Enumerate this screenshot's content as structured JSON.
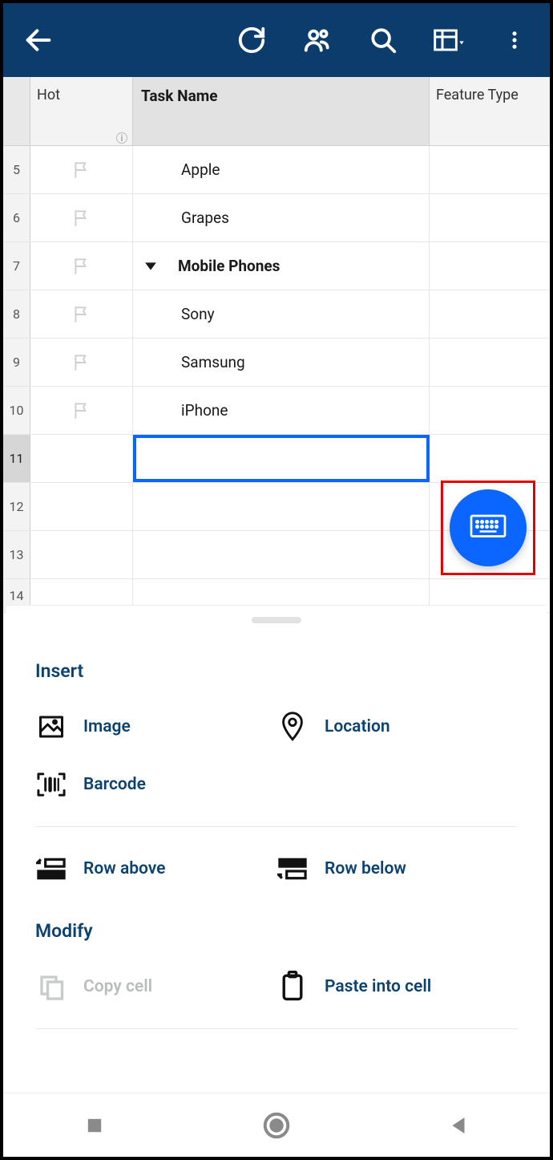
{
  "header": {},
  "columns": {
    "hot": "Hot",
    "task": "Task Name",
    "feature_type": "Feature Type"
  },
  "rows": [
    {
      "num": "5",
      "task": "Apple",
      "indent": 1,
      "group": false,
      "flag": true
    },
    {
      "num": "6",
      "task": "Grapes",
      "indent": 1,
      "group": false,
      "flag": true
    },
    {
      "num": "7",
      "task": "Mobile Phones",
      "indent": 0,
      "group": true,
      "flag": true
    },
    {
      "num": "8",
      "task": "Sony",
      "indent": 1,
      "group": false,
      "flag": true
    },
    {
      "num": "9",
      "task": "Samsung",
      "indent": 1,
      "group": false,
      "flag": true
    },
    {
      "num": "10",
      "task": "iPhone",
      "indent": 1,
      "group": false,
      "flag": true
    },
    {
      "num": "11",
      "task": "",
      "indent": 0,
      "group": false,
      "flag": false,
      "selected": true
    },
    {
      "num": "12",
      "task": "",
      "indent": 0,
      "group": false,
      "flag": false
    },
    {
      "num": "13",
      "task": "",
      "indent": 0,
      "group": false,
      "flag": false
    },
    {
      "num": "14",
      "task": "",
      "indent": 0,
      "group": false,
      "flag": false,
      "short": true
    }
  ],
  "sheet": {
    "sections": [
      {
        "title": "Insert",
        "options": [
          {
            "icon": "image",
            "label": "Image"
          },
          {
            "icon": "location",
            "label": "Location"
          },
          {
            "icon": "barcode",
            "label": "Barcode"
          },
          {
            "icon": "",
            "label": ""
          }
        ],
        "row_actions": [
          {
            "icon": "row-above",
            "label": "Row above"
          },
          {
            "icon": "row-below",
            "label": "Row below"
          }
        ]
      },
      {
        "title": "Modify",
        "options": [
          {
            "icon": "copy",
            "label": "Copy cell",
            "disabled": true
          },
          {
            "icon": "paste",
            "label": "Paste into cell"
          }
        ]
      }
    ]
  }
}
